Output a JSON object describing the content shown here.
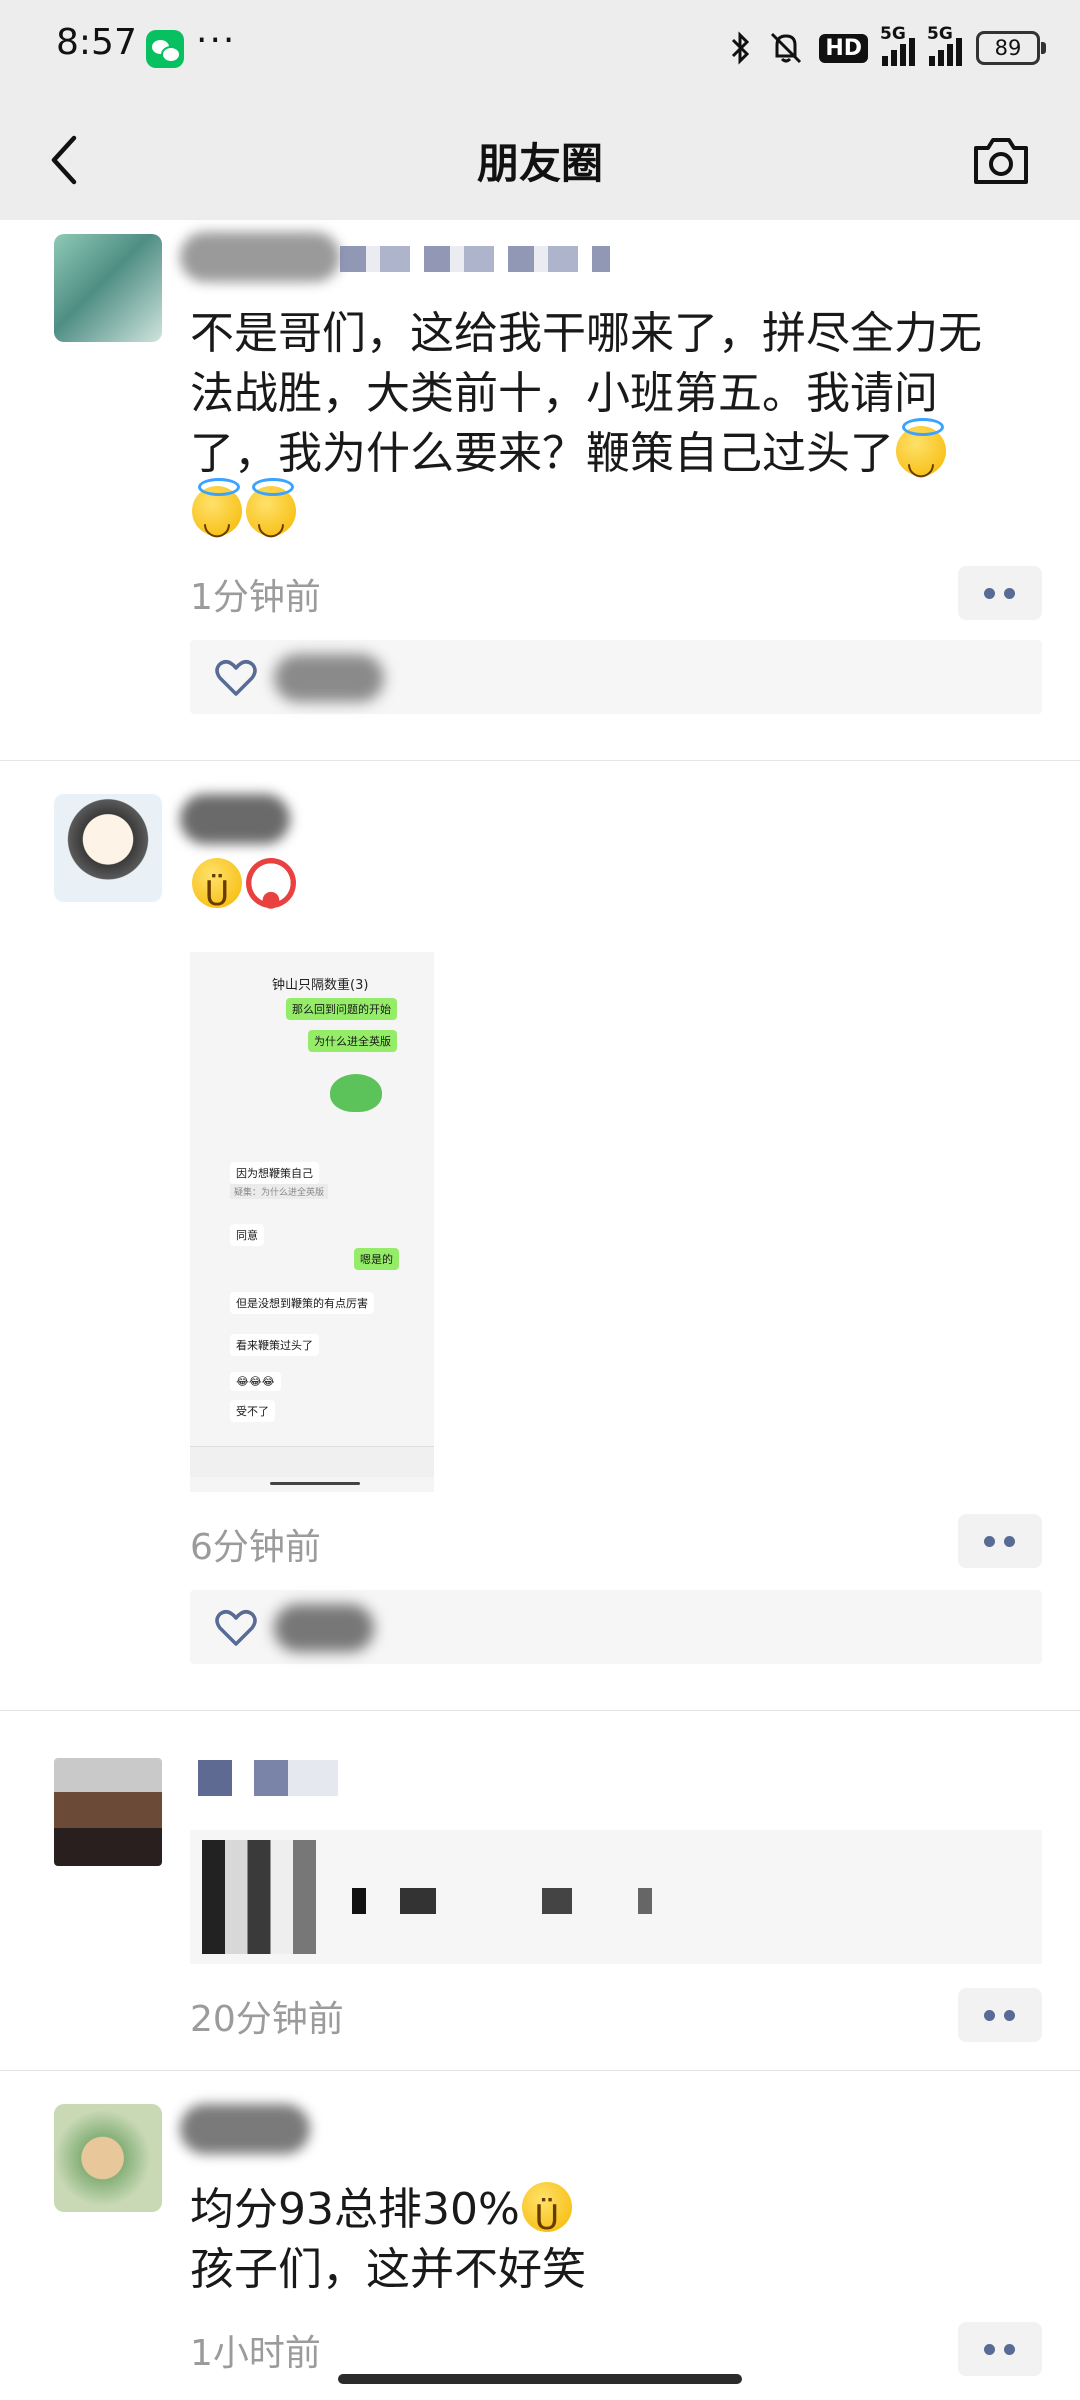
{
  "status_bar": {
    "time": "8:57",
    "dots": "···",
    "network_1": "5G",
    "network_2": "5G",
    "hd": "HD",
    "battery": "89"
  },
  "nav": {
    "title": "朋友圈",
    "back_icon": "chevron-left-icon",
    "camera_icon": "camera-icon"
  },
  "posts": [
    {
      "text_line1": "不是哥们，这给我干哪来了，拼尽全力无",
      "text_line2": "法战胜，大类前十，小班第五。我请问",
      "text_line3": "了，我为什么要来？鞭策自己过头了",
      "emoji": "smiling-face-with-halo",
      "time": "1分钟前"
    },
    {
      "emoji": "zany-face, clown-face",
      "time": "6分钟前",
      "screenshot": {
        "group_title": "钟山只隔数重(3)",
        "msg1": "那么回到问题的开始",
        "msg2": "为什么进全英版",
        "msg3": "因为想鞭策自己",
        "quote": "疑集：为什么进全英版",
        "msg4": "同意",
        "msg5": "嗯是的",
        "msg6": "但是没想到鞭策的有点厉害",
        "msg7": "看来鞭策过头了",
        "msg8": "受不了"
      }
    },
    {
      "time": "20分钟前"
    },
    {
      "text_line1": "均分93总排30%",
      "text_line2": "孩子们，这并不好笑",
      "emoji": "zany-face",
      "time": "1小时前"
    }
  ],
  "colors": {
    "header_bg": "#ededed",
    "link_blue": "#576b95",
    "timestamp_gray": "#9b9b9b",
    "bubble_green": "#95ec69"
  }
}
